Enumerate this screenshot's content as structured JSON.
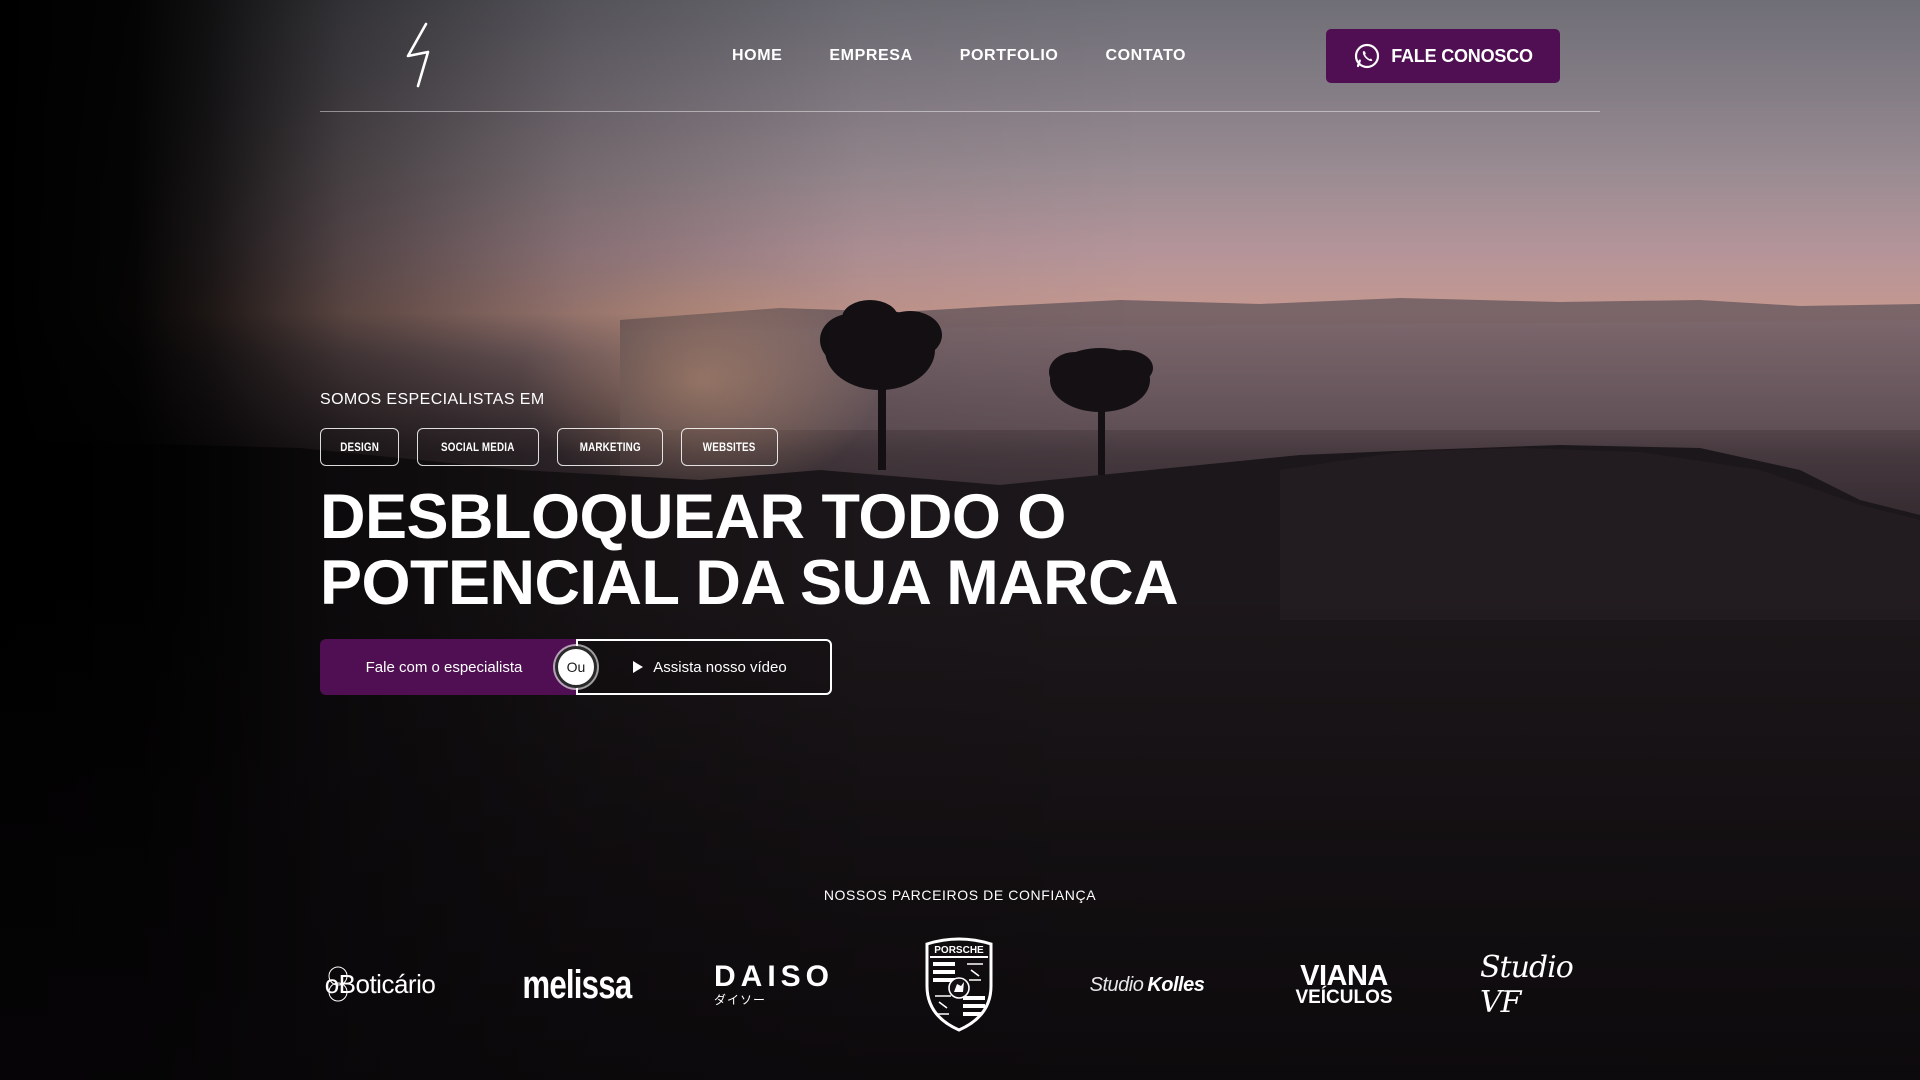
{
  "header": {
    "nav": [
      {
        "label": "HOME"
      },
      {
        "label": "EMPRESA"
      },
      {
        "label": "PORTFOLIO"
      },
      {
        "label": "CONTATO"
      }
    ],
    "cta_label": "FALE CONOSCO",
    "cta_icon": "whatsapp-icon",
    "logo_icon": "lightning-logo-icon"
  },
  "hero": {
    "eyebrow": "SOMOS ESPECIALISTAS EM",
    "tags": [
      "DESIGN",
      "SOCIAL MEDIA",
      "MARKETING",
      "WEBSITES"
    ],
    "headline_line1": "DESBLOQUEAR TODO O",
    "headline_line2": "POTENCIAL DA SUA MARCA",
    "primary_button": "Fale com o especialista",
    "divider_label": "Ou",
    "video_button": "Assista nosso vídeo",
    "video_icon": "play-icon"
  },
  "partners": {
    "title": "NOSSOS PARCEIROS DE CONFIANÇA",
    "logos": {
      "boticario": "oBoticário",
      "melissa": "melissa",
      "daiso": "DAISO",
      "daiso_sub": "ダイソー",
      "porsche": "PORSCHE",
      "kolles_1": "Studio",
      "kolles_2": "Kolles",
      "viana_1": "VIANA",
      "viana_2": "VEÍCULOS",
      "studiovf": "Studio VF"
    }
  },
  "colors": {
    "brand_purple": "#4f0f52",
    "text": "#ffffff",
    "background": "#0d0b0d"
  }
}
